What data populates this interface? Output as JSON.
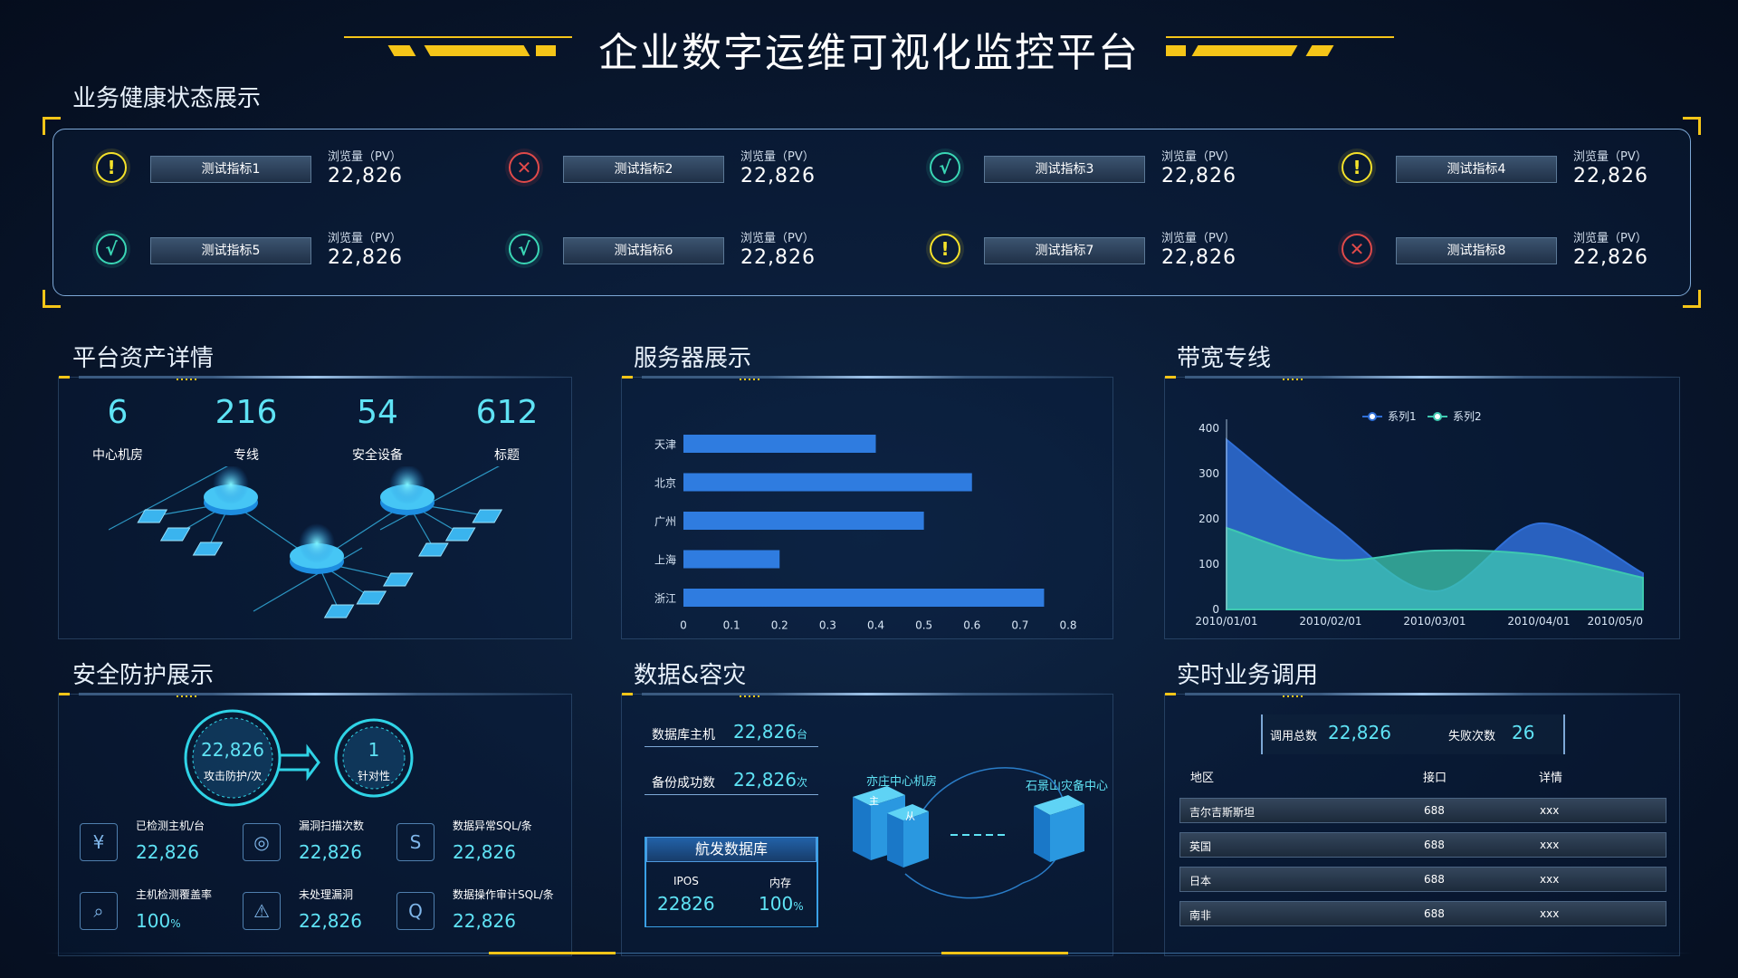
{
  "header": {
    "title": "企业数字运维可视化监控平台"
  },
  "health": {
    "title": "业务健康状态展示",
    "metrics": [
      {
        "name": "测试指标1",
        "status": "warning",
        "icon": "!",
        "pv_label": "浏览量（PV）",
        "value": "22,826"
      },
      {
        "name": "测试指标2",
        "status": "error",
        "icon": "✕",
        "pv_label": "浏览量（PV）",
        "value": "22,826"
      },
      {
        "name": "测试指标3",
        "status": "ok",
        "icon": "√",
        "pv_label": "浏览量（PV）",
        "value": "22,826"
      },
      {
        "name": "测试指标4",
        "status": "warning",
        "icon": "!",
        "pv_label": "浏览量（PV）",
        "value": "22,826"
      },
      {
        "name": "测试指标5",
        "status": "ok",
        "icon": "√",
        "pv_label": "浏览量（PV）",
        "value": "22,826"
      },
      {
        "name": "测试指标6",
        "status": "ok",
        "icon": "√",
        "pv_label": "浏览量（PV）",
        "value": "22,826"
      },
      {
        "name": "测试指标7",
        "status": "warning",
        "icon": "!",
        "pv_label": "浏览量（PV）",
        "value": "22,826"
      },
      {
        "name": "测试指标8",
        "status": "error",
        "icon": "✕",
        "pv_label": "浏览量（PV）",
        "value": "22,826"
      }
    ]
  },
  "assets": {
    "title": "平台资产详情",
    "stats": [
      {
        "value": "6",
        "label": "中心机房"
      },
      {
        "value": "216",
        "label": "专线"
      },
      {
        "value": "54",
        "label": "安全设备"
      },
      {
        "value": "612",
        "label": "标题"
      }
    ]
  },
  "servers": {
    "title": "服务器展示",
    "chart_data": {
      "type": "bar",
      "orientation": "horizontal",
      "categories": [
        "天津",
        "北京",
        "广州",
        "上海",
        "浙江"
      ],
      "values": [
        0.4,
        0.6,
        0.5,
        0.2,
        0.75
      ],
      "xticks": [
        "0",
        "0.1",
        "0.2",
        "0.3",
        "0.4",
        "0.5",
        "0.6",
        "0.7",
        "0.8"
      ],
      "xlim": [
        0,
        0.8
      ],
      "color": "#2f7ce0"
    }
  },
  "bandwidth": {
    "title": "带宽专线",
    "chart_data": {
      "type": "area",
      "x": [
        "2010/01/01",
        "2010/02/01",
        "2010/03/01",
        "2010/04/01",
        "2010/05/0"
      ],
      "series": [
        {
          "name": "系列1",
          "values": [
            375,
            190,
            40,
            190,
            80
          ],
          "color": "#2f6fd8"
        },
        {
          "name": "系列2",
          "values": [
            180,
            110,
            130,
            120,
            70
          ],
          "color": "#3ec9b0"
        }
      ],
      "yticks": [
        "0",
        "100",
        "200",
        "300",
        "400"
      ],
      "ylim": [
        0,
        400
      ],
      "legend": "top-center"
    }
  },
  "security": {
    "title": "安全防护展示",
    "attack": {
      "value": "22,826",
      "label": "攻击防护/次"
    },
    "target": {
      "value": "1",
      "label": "针对性"
    },
    "items": [
      {
        "label": "已检测主机/台",
        "value": "22,826",
        "icon": "money-bag-icon",
        "glyph": "¥"
      },
      {
        "label": "漏洞扫描次数",
        "value": "22,826",
        "icon": "scan-icon",
        "glyph": "◎"
      },
      {
        "label": "数据异常SQL/条",
        "value": "22,826",
        "icon": "sql-alert-icon",
        "glyph": "S"
      },
      {
        "label": "主机检测覆盖率",
        "value": "100",
        "unit": "%",
        "icon": "magnify-icon",
        "glyph": "⌕"
      },
      {
        "label": "未处理漏洞",
        "value": "22,826",
        "icon": "warning-icon",
        "glyph": "⚠"
      },
      {
        "label": "数据操作审计SQL/条",
        "value": "22,826",
        "icon": "sql-search-icon",
        "glyph": "Q"
      }
    ]
  },
  "data_dr": {
    "title": "数据&容灾",
    "db_hosts": {
      "label": "数据库主机",
      "value": "22,826",
      "unit": "台"
    },
    "backup": {
      "label": "备份成功数",
      "value": "22,826",
      "unit": "次"
    },
    "db_name": "航发数据库",
    "ipos_label": "IPOS",
    "ipos_value": "22826",
    "mem_label": "内存",
    "mem_value": "100",
    "mem_unit": "%",
    "site_main": "亦庄中心机房",
    "site_backup": "石景山灾备中心",
    "main_tag": "主",
    "backup_tag": "从"
  },
  "realtime": {
    "title": "实时业务调用",
    "total_label": "调用总数",
    "total_value": "22,826",
    "fail_label": "失败次数",
    "fail_value": "26",
    "columns": [
      "地区",
      "接口",
      "详情"
    ],
    "rows": [
      {
        "region": "吉尔吉斯斯坦",
        "api": "688",
        "detail": "xxx"
      },
      {
        "region": "英国",
        "api": "688",
        "detail": "xxx"
      },
      {
        "region": "日本",
        "api": "688",
        "detail": "xxx"
      },
      {
        "region": "南非",
        "api": "688",
        "detail": "xxx"
      }
    ]
  }
}
